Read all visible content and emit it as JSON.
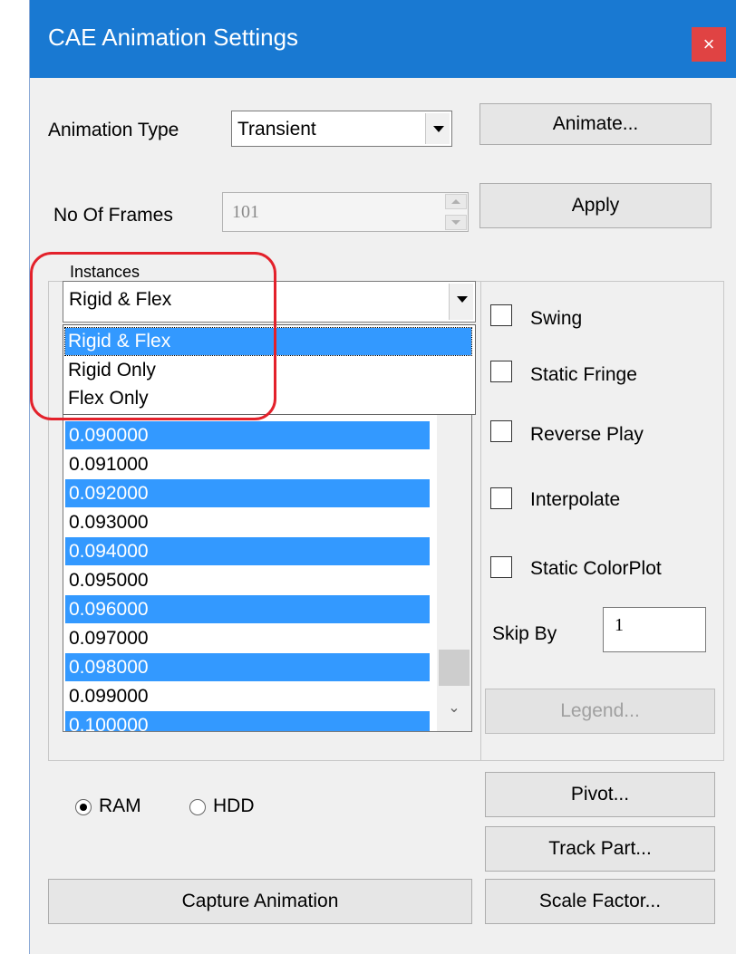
{
  "window": {
    "title": "CAE Animation Settings",
    "close_glyph": "×"
  },
  "animation_type": {
    "label": "Animation Type",
    "value": "Transient"
  },
  "frames": {
    "label": "No Of Frames",
    "value": "101"
  },
  "buttons": {
    "animate": "Animate...",
    "apply": "Apply",
    "legend": "Legend...",
    "pivot": "Pivot...",
    "track_part": "Track Part...",
    "scale_factor": "Scale Factor...",
    "capture": "Capture Animation"
  },
  "instances": {
    "label": "Instances",
    "value": "Rigid & Flex",
    "options": [
      "Rigid & Flex",
      "Rigid Only",
      "Flex Only"
    ],
    "highlighted_index": 0
  },
  "time_list": {
    "rows": [
      {
        "text": "0.090000",
        "selected": true
      },
      {
        "text": "0.091000",
        "selected": false
      },
      {
        "text": "0.092000",
        "selected": true
      },
      {
        "text": "0.093000",
        "selected": false
      },
      {
        "text": "0.094000",
        "selected": true
      },
      {
        "text": "0.095000",
        "selected": false
      },
      {
        "text": "0.096000",
        "selected": true
      },
      {
        "text": "0.097000",
        "selected": false
      },
      {
        "text": "0.098000",
        "selected": true
      },
      {
        "text": "0.099000",
        "selected": false
      },
      {
        "text": "0.100000",
        "selected": true
      }
    ]
  },
  "options": {
    "swing": "Swing",
    "static_fringe": "Static Fringe",
    "reverse_play": "Reverse Play",
    "interpolate": "Interpolate",
    "static_colorplot": "Static ColorPlot"
  },
  "skip_by": {
    "label": "Skip By",
    "value": "1"
  },
  "storage": {
    "ram": "RAM",
    "hdd": "HDD",
    "selected": "RAM"
  },
  "colors": {
    "title_bar": "#1979d2",
    "selection": "#3399ff",
    "callout": "#e3212b",
    "close": "#e04343"
  }
}
